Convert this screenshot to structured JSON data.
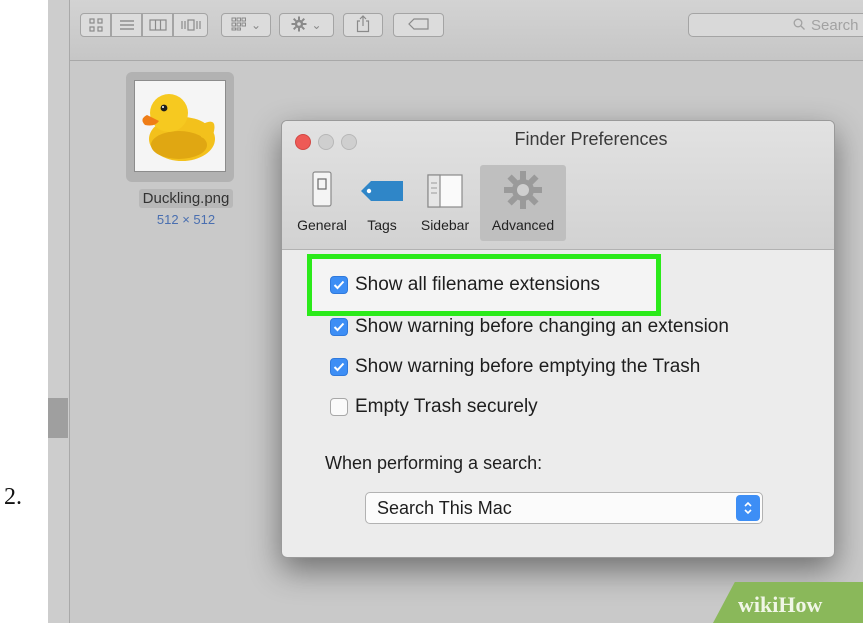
{
  "step_number": "2.",
  "toolbar": {
    "view_icons": [
      "icon-view-icon",
      "list-view-icon",
      "column-view-icon",
      "cover-flow-icon"
    ],
    "arrange_icon": "arrange-grid-icon",
    "action_icon": "gear-icon",
    "share_icon": "share-icon",
    "tag_icon": "tag-icon",
    "dropdown_glyph": "⌄",
    "search_placeholder": "Search"
  },
  "file": {
    "name": "Duckling.png",
    "dimensions": "512 × 512",
    "icon": "rubber-duck-image"
  },
  "dialog": {
    "title": "Finder Preferences",
    "tabs": [
      {
        "label": "General",
        "icon": "general-icon",
        "active": false
      },
      {
        "label": "Tags",
        "icon": "tag-icon",
        "active": false
      },
      {
        "label": "Sidebar",
        "icon": "sidebar-icon",
        "active": false
      },
      {
        "label": "Advanced",
        "icon": "gear-icon",
        "active": true
      }
    ],
    "options": [
      {
        "label": "Show all filename extensions",
        "checked": true,
        "highlighted": true
      },
      {
        "label": "Show warning before changing an extension",
        "checked": true
      },
      {
        "label": "Show warning before emptying the Trash",
        "checked": true
      },
      {
        "label": "Empty Trash securely",
        "checked": false
      }
    ],
    "search_section_label": "When performing a search:",
    "search_scope": "Search This Mac"
  },
  "watermark": {
    "text_a": "wiki",
    "text_b": "How"
  },
  "colors": {
    "accent_blue": "#3d8ef5",
    "highlight_green": "#2bea1a",
    "close_red": "#ee5a56",
    "watermark_green": "#8ab85a"
  }
}
